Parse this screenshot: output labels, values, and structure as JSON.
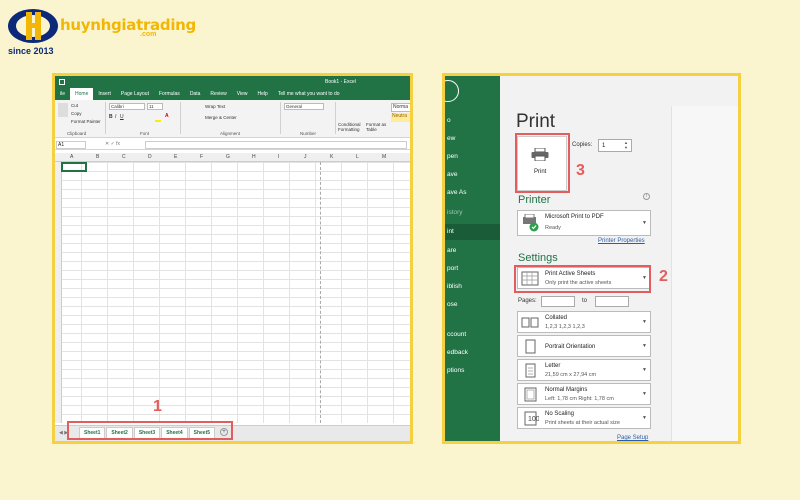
{
  "logo": {
    "name": "huynhgiatrading",
    "suffix": ".com",
    "since": "since 2013"
  },
  "colors": {
    "excel_green": "#217346",
    "highlight_red": "#e25d5d",
    "frame_yellow": "#f5d142",
    "brand_blue": "#0d2a7a",
    "brand_yellow": "#f2b705"
  },
  "excel": {
    "title": "Book1 - Excel",
    "tabs": [
      "ile",
      "Home",
      "Insert",
      "Page Layout",
      "Formulas",
      "Data",
      "Review",
      "View",
      "Help",
      "Tell me what you want to do"
    ],
    "ribbon": {
      "paste_group": [
        "Cut",
        "Copy",
        "Format Painter"
      ],
      "clipboard": "Clipboard",
      "font_name": "Calibri",
      "font_size": "11",
      "font_group": "Font",
      "wrap_text": "Wrap Text",
      "merge_center": "Merge & Center",
      "alignment_group": "Alignment",
      "number_format": "General",
      "number_group": "Number",
      "conditional": "Conditional Formatting",
      "format_as_table": "Format as Table",
      "style_normal": "Norma",
      "style_neutral": "Neutra"
    },
    "name_box": "A1",
    "columns": [
      "A",
      "B",
      "C",
      "D",
      "E",
      "F",
      "G",
      "H",
      "I",
      "J",
      "K",
      "L",
      "M"
    ],
    "sheets": [
      "Sheet1",
      "Sheet2",
      "Sheet3",
      "Sheet4",
      "Sheet5"
    ],
    "add_sheet": "+",
    "callout": "1"
  },
  "backstage": {
    "nav": [
      "o",
      "ew",
      "pen",
      "ave",
      "ave As",
      "istory",
      "int",
      "are",
      "port",
      "iblish",
      "ose",
      "ccount",
      "edback",
      "ptions"
    ],
    "title": "Print",
    "print_button": "Print",
    "copies_label": "Copies:",
    "copies_value": "1",
    "printer_header": "Printer",
    "printer_name": "Microsoft Print to PDF",
    "printer_status": "Ready",
    "printer_properties": "Printer Properties",
    "settings_header": "Settings",
    "settings": [
      {
        "title": "Print Active Sheets",
        "sub": "Only print the active sheets",
        "icon": "sheets-icon"
      },
      {
        "title": "Collated",
        "sub": "1,2,3    1,2,3    1,2,3",
        "icon": "collated-icon"
      },
      {
        "title": "Portrait Orientation",
        "sub": "",
        "icon": "portrait-icon"
      },
      {
        "title": "Letter",
        "sub": "21,59 cm x 27,94 cm",
        "icon": "paper-icon"
      },
      {
        "title": "Normal Margins",
        "sub": "Left:  1,78 cm    Right:  1,78 cm",
        "icon": "margins-icon"
      },
      {
        "title": "No Scaling",
        "sub": "Print sheets at their actual size",
        "icon": "scaling-icon"
      }
    ],
    "pages_label": "Pages:",
    "to_label": "to",
    "page_setup": "Page Setup",
    "callout_print": "3",
    "callout_settings": "2"
  }
}
